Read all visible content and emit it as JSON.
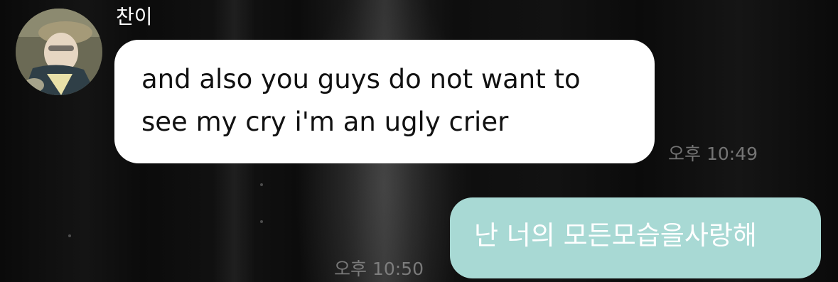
{
  "sender": {
    "name": "찬이"
  },
  "messages": [
    {
      "direction": "incoming",
      "text_line1": "and also you guys do not want to",
      "text_line2": "see my cry i'm an ugly crier",
      "time": "오후 10:49"
    },
    {
      "direction": "outgoing",
      "text": "난 너의 모든모습을사랑해",
      "time": "오후 10:50"
    }
  ],
  "colors": {
    "incoming_bubble": "#ffffff",
    "outgoing_bubble": "#a8d9d4",
    "background": "#0d0d0d",
    "timestamp": "#969696"
  },
  "icons": {
    "avatar": "profile-photo"
  }
}
